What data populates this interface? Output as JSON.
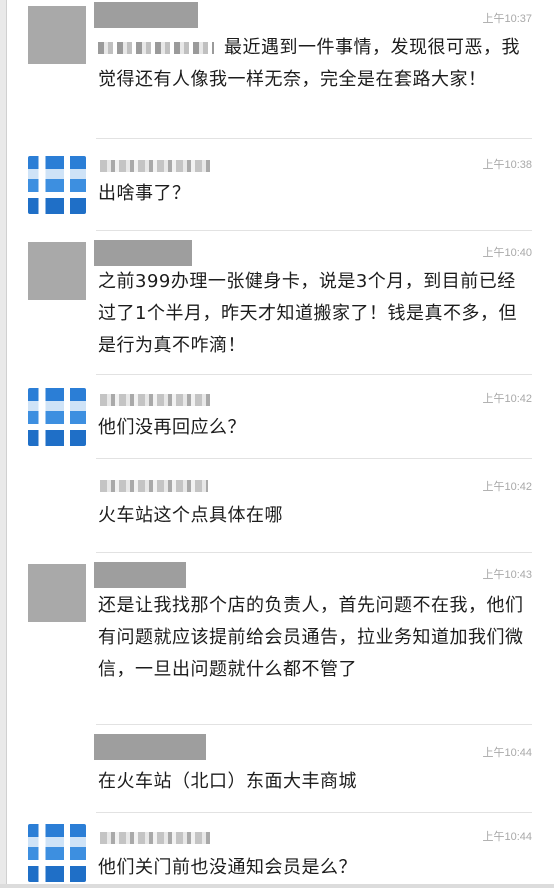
{
  "messages": [
    {
      "time": "上午10:37",
      "text": "最近遇到一件事情，发现很可恶，我觉得还有人像我一样无奈，完全是在套路大家！"
    },
    {
      "time": "上午10:38",
      "text": "出啥事了？"
    },
    {
      "time": "上午10:40",
      "text": "之前399办理一张健身卡，说是3个月，到目前已经过了1个半月，昨天才知道搬家了！钱是真不多，但是行为真不咋滴！"
    },
    {
      "time": "上午10:42",
      "text": "他们没再回应么？"
    },
    {
      "time": "上午10:42",
      "text": "火车站这个点具体在哪"
    },
    {
      "time": "上午10:43",
      "text": "还是让我找那个店的负责人，首先问题不在我，他们有问题就应该提前给会员通告，拉业务知道加我们微信，一旦出问题就什么都不管了"
    },
    {
      "time": "上午10:44",
      "text": "在火车站（北口）东面大丰商城"
    },
    {
      "time": "上午10:44",
      "text": "他们关门前也没通知会员是么？"
    }
  ]
}
